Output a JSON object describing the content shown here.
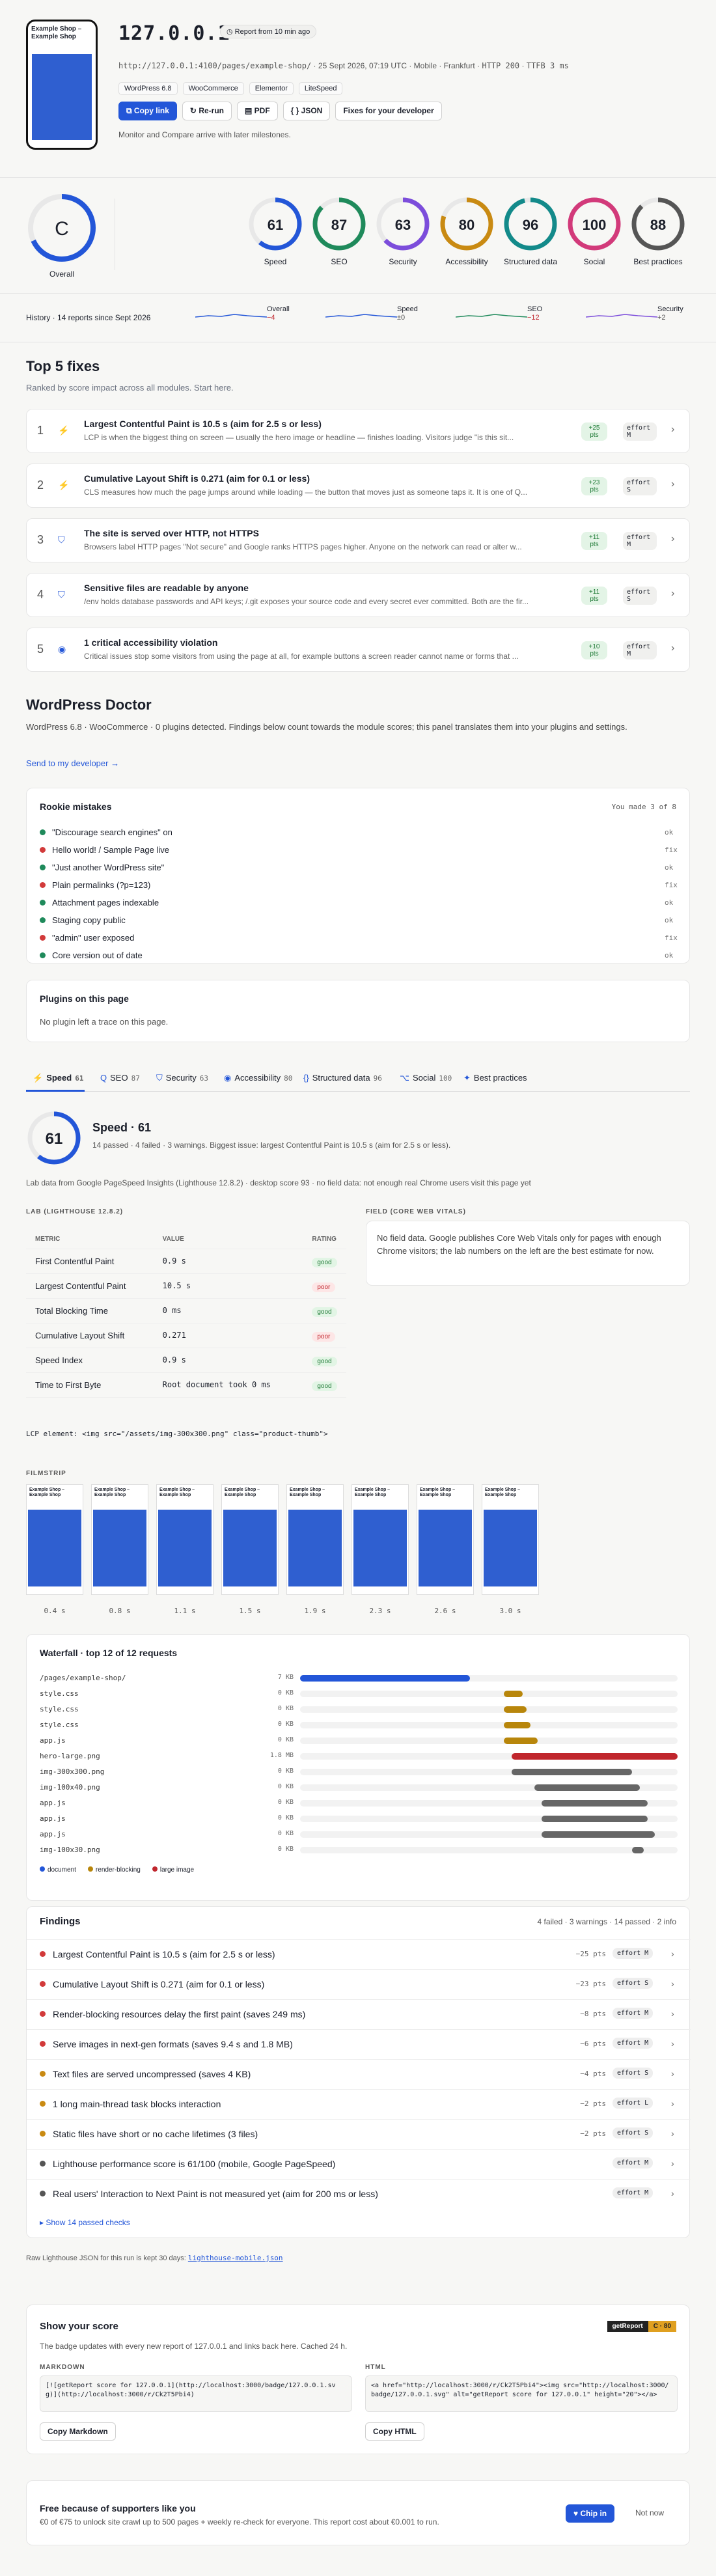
{
  "header": {
    "thumb_title": "Example Shop – Example Shop",
    "ip": "127.0.0.1",
    "report_age": "Report from 10 min ago",
    "url": "http://127.0.0.1:4100/pages/example-shop/",
    "date": "25 Sept 2026, 07:19 UTC",
    "device": "Mobile · Frankfurt",
    "http": "HTTP 200",
    "ttfb": "TTFB 3 ms",
    "tags": [
      "WordPress 6.8",
      "WooCommerce",
      "Elementor",
      "LiteSpeed"
    ],
    "actions": {
      "copy": "Copy link",
      "rerun": "Re-run",
      "pdf": "PDF",
      "json": "{ } JSON",
      "dev": "Fixes for your developer"
    },
    "motto": "Monitor and Compare arrive with later milestones."
  },
  "overall": {
    "grade": "C",
    "label": "Overall"
  },
  "scores": [
    {
      "label": "Speed",
      "value": "61",
      "color": "#2356d8"
    },
    {
      "label": "SEO",
      "value": "87",
      "color": "#1f8a5b"
    },
    {
      "label": "Security",
      "value": "63",
      "color": "#7c4ddb"
    },
    {
      "label": "Accessibility",
      "value": "80",
      "color": "#c98a12"
    },
    {
      "label": "Structured data",
      "value": "96",
      "color": "#138a8a"
    },
    {
      "label": "Social",
      "value": "100",
      "color": "#d23a7a"
    },
    {
      "label": "Best practices",
      "value": "88",
      "color": "#555555"
    }
  ],
  "history": {
    "label": "History · 14 reports since Sept 2026",
    "items": [
      {
        "name": "Overall",
        "delta": "−4"
      },
      {
        "name": "Speed",
        "delta": "±0"
      },
      {
        "name": "SEO",
        "delta": "−12"
      },
      {
        "name": "Security",
        "delta": "+2"
      }
    ]
  },
  "fixes": {
    "title": "Top 5 fixes",
    "sub": "Ranked by score impact across all modules. Start here.",
    "items": [
      {
        "n": "1",
        "icon": "⚡",
        "t": "Largest Contentful Paint is 10.5 s (aim for 2.5 s or less)",
        "d": "LCP is when the biggest thing on screen — usually the hero image or headline — finishes loading. Visitors judge \"is this sit...",
        "pts": "+25 pts",
        "eff": "effort M"
      },
      {
        "n": "2",
        "icon": "⚡",
        "t": "Cumulative Layout Shift is 0.271 (aim for 0.1 or less)",
        "d": "CLS measures how much the page jumps around while loading — the button that moves just as someone taps it. It is one of Q...",
        "pts": "+23 pts",
        "eff": "effort S"
      },
      {
        "n": "3",
        "icon": "⛉",
        "t": "The site is served over HTTP, not HTTPS",
        "d": "Browsers label HTTP pages \"Not secure\" and Google ranks HTTPS pages higher. Anyone on the network can read or alter w...",
        "pts": "+11 pts",
        "eff": "effort M"
      },
      {
        "n": "4",
        "icon": "⛉",
        "t": "Sensitive files are readable by anyone",
        "d": "/env holds database passwords and API keys; /.git exposes your source code and every secret ever committed. Both are the fir...",
        "pts": "+11 pts",
        "eff": "effort S"
      },
      {
        "n": "5",
        "icon": "◉",
        "t": "1 critical accessibility violation",
        "d": "Critical issues stop some visitors from using the page at all, for example buttons a screen reader cannot name or forms that ...",
        "pts": "+10 pts",
        "eff": "effort M"
      }
    ]
  },
  "wpdoc": {
    "title": "WordPress Doctor",
    "desc": "WordPress 6.8 · WooCommerce · 0 plugins detected. Findings below count towards the module scores; this panel translates them into your plugins and settings.",
    "link": "Send to my developer →",
    "rookie_title": "Rookie mistakes",
    "made": "You made 3 of 8",
    "items": [
      {
        "t": "\"Discourage search engines\" on",
        "c": "#1f8a5b",
        "x": "ok"
      },
      {
        "t": "Hello world! / Sample Page live",
        "c": "#d23a3a",
        "x": "fix"
      },
      {
        "t": "\"Just another WordPress site\"",
        "c": "#1f8a5b",
        "x": "ok"
      },
      {
        "t": "Plain permalinks (?p=123)",
        "c": "#d23a3a",
        "x": "fix"
      },
      {
        "t": "Attachment pages indexable",
        "c": "#1f8a5b",
        "x": "ok"
      },
      {
        "t": "Staging copy public",
        "c": "#1f8a5b",
        "x": "ok"
      },
      {
        "t": "\"admin\" user exposed",
        "c": "#d23a3a",
        "x": "fix"
      },
      {
        "t": "Core version out of date",
        "c": "#1f8a5b",
        "x": "ok"
      }
    ],
    "plugins_title": "Plugins on this page",
    "plugins_empty": "No plugin left a trace on this page."
  },
  "tabs": [
    {
      "icon": "⚡",
      "t": "Speed",
      "v": "61"
    },
    {
      "icon": "Q",
      "t": "SEO",
      "v": "87"
    },
    {
      "icon": "⛉",
      "t": "Security",
      "v": "63"
    },
    {
      "icon": "◉",
      "t": "Accessibility",
      "v": "80"
    },
    {
      "icon": "{}",
      "t": "Structured data",
      "v": "96"
    },
    {
      "icon": "⌥",
      "t": "Social",
      "v": "100"
    },
    {
      "icon": "✦",
      "t": "Best practices",
      "v": ""
    }
  ],
  "speed": {
    "score": "61",
    "title": "Speed · 61",
    "summary": "14 passed · 4 failed · 3 warnings. Biggest issue: largest Contentful Paint is 10.5 s (aim for 2.5 s or less).",
    "note": "Lab data from Google PageSpeed Insights (Lighthouse 12.8.2) · desktop score 93 · no field data: not enough real Chrome users visit this page yet",
    "lab_title": "LAB (LIGHTHOUSE 12.8.2)",
    "field_title": "FIELD (CORE WEB VITALS)",
    "field_text": "No field data. Google publishes Core Web Vitals only for pages with enough Chrome visitors; the lab numbers on the left are the best estimate for now.",
    "cols": {
      "m": "METRIC",
      "v": "VALUE",
      "r": "RATING"
    },
    "rows": [
      {
        "m": "First Contentful Paint",
        "v": "0.9 s",
        "r": "good"
      },
      {
        "m": "Largest Contentful Paint",
        "v": "10.5 s",
        "r": "poor"
      },
      {
        "m": "Total Blocking Time",
        "v": "0 ms",
        "r": "good"
      },
      {
        "m": "Cumulative Layout Shift",
        "v": "0.271",
        "r": "poor"
      },
      {
        "m": "Speed Index",
        "v": "0.9 s",
        "r": "good"
      },
      {
        "m": "Time to First Byte",
        "v": "Root document took 0 ms",
        "r": "good"
      }
    ],
    "lcp_el": "LCP element: <img src=\"/assets/img-300x300.png\" class=\"product-thumb\">",
    "film_title": "FILMSTRIP",
    "film_frame": "Example Shop – Example Shop",
    "film": [
      "0.4 s",
      "0.8 s",
      "1.1 s",
      "1.5 s",
      "1.9 s",
      "2.3 s",
      "2.6 s",
      "3.0 s"
    ]
  },
  "waterfall": {
    "title": "Waterfall · top 12 of 12 requests",
    "rows": [
      {
        "f": "/pages/example-shop/",
        "s": "7 KB",
        "st": 0,
        "w": 0.45,
        "c": "#2356d8"
      },
      {
        "f": "style.css",
        "s": "0 KB",
        "st": 0.54,
        "w": 0.05,
        "c": "#b8860b"
      },
      {
        "f": "style.css",
        "s": "0 KB",
        "st": 0.54,
        "w": 0.06,
        "c": "#b8860b"
      },
      {
        "f": "style.css",
        "s": "0 KB",
        "st": 0.54,
        "w": 0.07,
        "c": "#b8860b"
      },
      {
        "f": "app.js",
        "s": "0 KB",
        "st": 0.54,
        "w": 0.09,
        "c": "#b8860b"
      },
      {
        "f": "hero-large.png",
        "s": "1.8 MB",
        "st": 0.56,
        "w": 0.44,
        "c": "#c0262d"
      },
      {
        "f": "img-300x300.png",
        "s": "0 KB",
        "st": 0.56,
        "w": 0.32,
        "c": "#666"
      },
      {
        "f": "img-100x40.png",
        "s": "0 KB",
        "st": 0.62,
        "w": 0.28,
        "c": "#666"
      },
      {
        "f": "app.js",
        "s": "0 KB",
        "st": 0.64,
        "w": 0.28,
        "c": "#666"
      },
      {
        "f": "app.js",
        "s": "0 KB",
        "st": 0.64,
        "w": 0.28,
        "c": "#666"
      },
      {
        "f": "app.js",
        "s": "0 KB",
        "st": 0.64,
        "w": 0.3,
        "c": "#666"
      },
      {
        "f": "img-100x30.png",
        "s": "0 KB",
        "st": 0.88,
        "w": 0.03,
        "c": "#666"
      }
    ],
    "legend": [
      "document",
      "render-blocking",
      "large image"
    ]
  },
  "findings": {
    "title": "Findings",
    "counts": "4 failed · 3 warnings · 14 passed · 2 info",
    "rows": [
      {
        "t": "Largest Contentful Paint is 10.5 s (aim for 2.5 s or less)",
        "p": "−25 pts",
        "e": "effort M",
        "c": "#d23a3a"
      },
      {
        "t": "Cumulative Layout Shift is 0.271 (aim for 0.1 or less)",
        "p": "−23 pts",
        "e": "effort S",
        "c": "#d23a3a"
      },
      {
        "t": "Render-blocking resources delay the first paint (saves 249 ms)",
        "p": "−8 pts",
        "e": "effort M",
        "c": "#d23a3a"
      },
      {
        "t": "Serve images in next-gen formats (saves 9.4 s and 1.8 MB)",
        "p": "−6 pts",
        "e": "effort M",
        "c": "#d23a3a"
      },
      {
        "t": "Text files are served uncompressed (saves 4 KB)",
        "p": "−4 pts",
        "e": "effort S",
        "c": "#c98a12"
      },
      {
        "t": "1 long main-thread task blocks interaction",
        "p": "−2 pts",
        "e": "effort L",
        "c": "#c98a12"
      },
      {
        "t": "Static files have short or no cache lifetimes (3 files)",
        "p": "−2 pts",
        "e": "effort S",
        "c": "#c98a12"
      },
      {
        "t": "Lighthouse performance score is 61/100 (mobile, Google PageSpeed)",
        "p": "",
        "e": "effort M",
        "c": "#555"
      },
      {
        "t": "Real users' Interaction to Next Paint is not measured yet (aim for 200 ms or less)",
        "p": "",
        "e": "effort M",
        "c": "#555"
      }
    ],
    "show": "Show 14 passed checks"
  },
  "raw": {
    "text": "Raw Lighthouse JSON for this run is kept 30 days:",
    "link": "lighthouse-mobile.json"
  },
  "badge": {
    "title": "Show your score",
    "desc": "The badge updates with every new report of 127.0.0.1 and links back here. Cached 24 h.",
    "brand": "getReport",
    "brand_score": "C · 80",
    "md_label": "MARKDOWN",
    "md_code": "[![getReport score for 127.0.0.1](http://localhost:3000/badge/127.0.0.1.svg)](http://localhost:3000/r/Ck2T5Pbi4)",
    "html_label": "HTML",
    "html_code": "<a href=\"http://localhost:3000/r/Ck2T5Pbi4\"><img src=\"http://localhost:3000/badge/127.0.0.1.svg\" alt=\"getReport score for 127.0.0.1\" height=\"20\"></a>",
    "copy_md": "Copy Markdown",
    "copy_html": "Copy HTML"
  },
  "support": {
    "title": "Free because of supporters like you",
    "desc": "€0 of €75 to unlock site crawl up to 500 pages + weekly re-check for everyone. This report cost about €0.001 to run.",
    "chip": "Chip in",
    "later": "Not now"
  }
}
